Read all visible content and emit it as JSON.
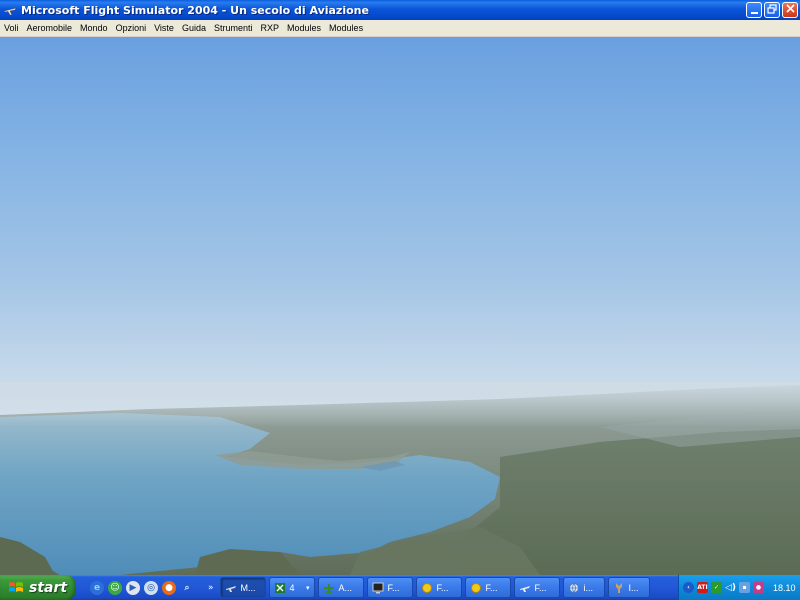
{
  "window": {
    "title": "Microsoft Flight Simulator 2004 - Un secolo di Aviazione",
    "icon": "plane-icon",
    "controls": [
      "minimize-icon",
      "restore-icon",
      "close-icon"
    ]
  },
  "menu": {
    "items": [
      "Voli",
      "Aeromobile",
      "Mondo",
      "Opzioni",
      "Viste",
      "Guida",
      "Strumenti",
      "RXP",
      "Modules",
      "Modules"
    ]
  },
  "taskbar": {
    "start_label": "start",
    "quicklaunch": [
      "ie-icon",
      "messenger-icon",
      "media-icon",
      "app-icon",
      "firefox-icon",
      "search-icon"
    ],
    "more": "»",
    "tasks": [
      {
        "label": "M...",
        "icon": "plane-icon",
        "active": true
      },
      {
        "label": "4",
        "icon": "excel-icon",
        "active": false,
        "group": true
      },
      {
        "label": "A...",
        "icon": "airplane-app-icon",
        "active": false
      },
      {
        "label": "F...",
        "icon": "monitor-icon",
        "active": false
      },
      {
        "label": "F...",
        "icon": "sun-icon",
        "active": false
      },
      {
        "label": "F...",
        "icon": "sun-icon",
        "active": false
      },
      {
        "label": "F...",
        "icon": "plane-icon",
        "active": false
      },
      {
        "label": "i...",
        "icon": "globe-icon",
        "active": false
      },
      {
        "label": "I...",
        "icon": "tool-icon",
        "active": false
      }
    ],
    "clock": "18.10"
  },
  "colors": {
    "sky_top": "#6aa0e0",
    "horizon": "#d3e1ec",
    "sea": "#5f9bbf",
    "land": "#6f7c6a"
  }
}
